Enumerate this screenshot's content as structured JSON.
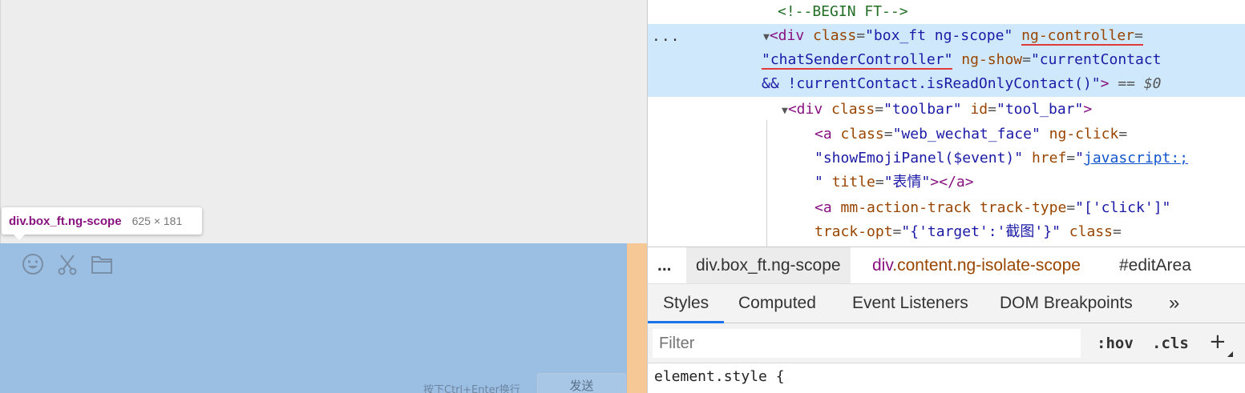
{
  "page": {
    "hint_text": "按下Ctrl+Enter换行",
    "send_label": "发送",
    "toolbar_icons": [
      "smiley-icon",
      "scissors-icon",
      "folder-icon"
    ]
  },
  "tooltip": {
    "element_name": "div.box_ft.ng-scope",
    "element_size": "625 × 181"
  },
  "dom": {
    "comment": "<!--BEGIN FT-->",
    "row_dots": "...",
    "line1": {
      "open": "<div",
      "class_attr": "class",
      "class_val": "\"box_ft ng-scope\"",
      "ctrl_attr": "ng-controller",
      "eq": "="
    },
    "line2": {
      "ctrl_val": "\"chatSenderController\"",
      "show_attr": "ng-show",
      "show_val_start": "\"currentContact"
    },
    "line3": {
      "show_val_end": "&& !currentContact.isReadOnlyContact()\"",
      "close": ">",
      "console_ref": "== $0"
    },
    "toolbar_line": {
      "open": "<div",
      "class_attr": "class",
      "class_val": "\"toolbar\"",
      "id_attr": "id",
      "id_val": "\"tool_bar\"",
      "close": ">"
    },
    "a1": {
      "open": "<a",
      "class_attr": "class",
      "class_val": "\"web_wechat_face\"",
      "click_attr": "ng-click",
      "eq": "=",
      "click_val": "\"showEmojiPanel($event)\"",
      "href_attr": "href",
      "href_val_q": "\"",
      "href_val": "javascript:;",
      "title_cont": "\"",
      "title_attr": "title",
      "title_val": "\"表情\"",
      "close": "></a>"
    },
    "a2": {
      "open": "<a",
      "attr1": "mm-action-track",
      "attr2": "track-type",
      "val2": "\"['click']\"",
      "attr3": "track-opt",
      "val3": "\"{'target':'截图'}\"",
      "attr4": "class",
      "eq": "="
    }
  },
  "breadcrumbs": {
    "dots": "...",
    "items": [
      {
        "tag": "div",
        "rest": ".box_ft.ng-scope"
      },
      {
        "tag": "div",
        "rest": ".content.ng-isolate-scope"
      },
      {
        "tag": "",
        "rest": "#editArea"
      }
    ]
  },
  "tabs": [
    "Styles",
    "Computed",
    "Event Listeners",
    "DOM Breakpoints",
    "»"
  ],
  "filter": {
    "placeholder": "Filter",
    "hov": ":hov",
    "cls": ".cls",
    "plus": "+"
  },
  "styles": {
    "first_rule": "element.style {"
  }
}
